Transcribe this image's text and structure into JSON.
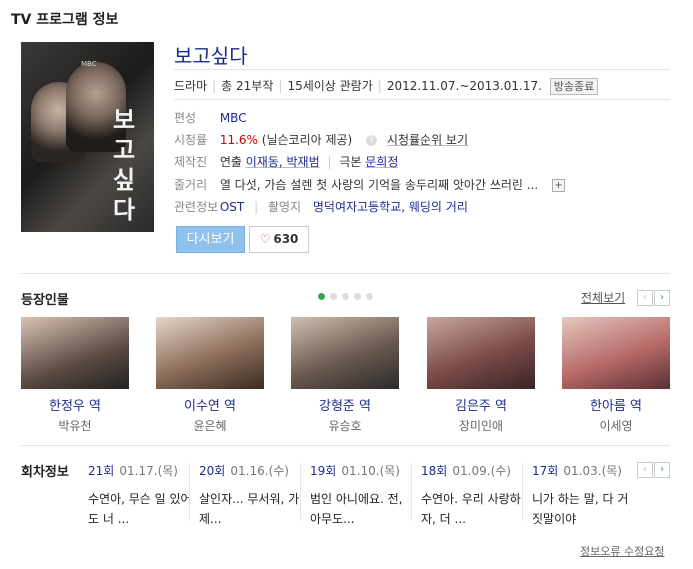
{
  "header": {
    "title": "TV 프로그램 정보"
  },
  "poster": {
    "title_text": "보고싶다",
    "logo": "MBC"
  },
  "show": {
    "title": "보고싶다",
    "genre": "드라마",
    "episodes": "총 21부작",
    "rating_age": "15세이상 관람가",
    "period": "2012.11.07.~2013.01.17.",
    "status_badge": "방송종료"
  },
  "info": {
    "channel_label": "편성",
    "channel_value": "MBC",
    "viewership_label": "시청률",
    "viewership_value": "11.6%",
    "viewership_source": "(닐슨코리아 제공)",
    "viewership_rank_link": "시청률순위 보기",
    "staff_label": "제작진",
    "director_prefix": "연출",
    "director_value": "이재동, 박재범",
    "writer_prefix": "극본",
    "writer_value": "문희정",
    "synopsis_label": "줄거리",
    "synopsis_value": "열 다섯, 가슴 설렌 첫 사랑의 기억을 송두리째 앗아간 쓰러린 ...",
    "related_label": "관련정보",
    "related_value": "OST",
    "location_label": "촬영지",
    "location_value": "명덕여자고등학교, 웨딩의 거리"
  },
  "actions": {
    "rewatch_label": "다시보기",
    "likes_count": "630"
  },
  "cast_section": {
    "title": "등장인물",
    "view_all": "전체보기",
    "members": [
      {
        "role": "한정우 역",
        "actor": "박유천"
      },
      {
        "role": "이수연 역",
        "actor": "윤은혜"
      },
      {
        "role": "강형준 역",
        "actor": "유승호"
      },
      {
        "role": "김은주 역",
        "actor": "장미인애"
      },
      {
        "role": "한아름 역",
        "actor": "이세영"
      }
    ]
  },
  "episodes_section": {
    "title": "회차정보",
    "items": [
      {
        "num": "21회",
        "date": "01.17.(목)",
        "summary": "수연아, 무슨 일 있어도 너 ..."
      },
      {
        "num": "20회",
        "date": "01.16.(수)",
        "summary": "살인자... 무서워, 가 제..."
      },
      {
        "num": "19회",
        "date": "01.10.(목)",
        "summary": "범인 아니에요. 전, 아무도..."
      },
      {
        "num": "18회",
        "date": "01.09.(수)",
        "summary": "수연아. 우리 사랑하자, 더 ..."
      },
      {
        "num": "17회",
        "date": "01.03.(목)",
        "summary": "니가 하는 말, 다 거짓말이야"
      }
    ]
  },
  "footer": {
    "report_link": "정보오류 수정요청"
  },
  "colors": {
    "link": "#1e2b8f",
    "accent_green": "#3aa34a",
    "button_blue": "#8fc1ef",
    "viewership_red": "#cc0000"
  }
}
